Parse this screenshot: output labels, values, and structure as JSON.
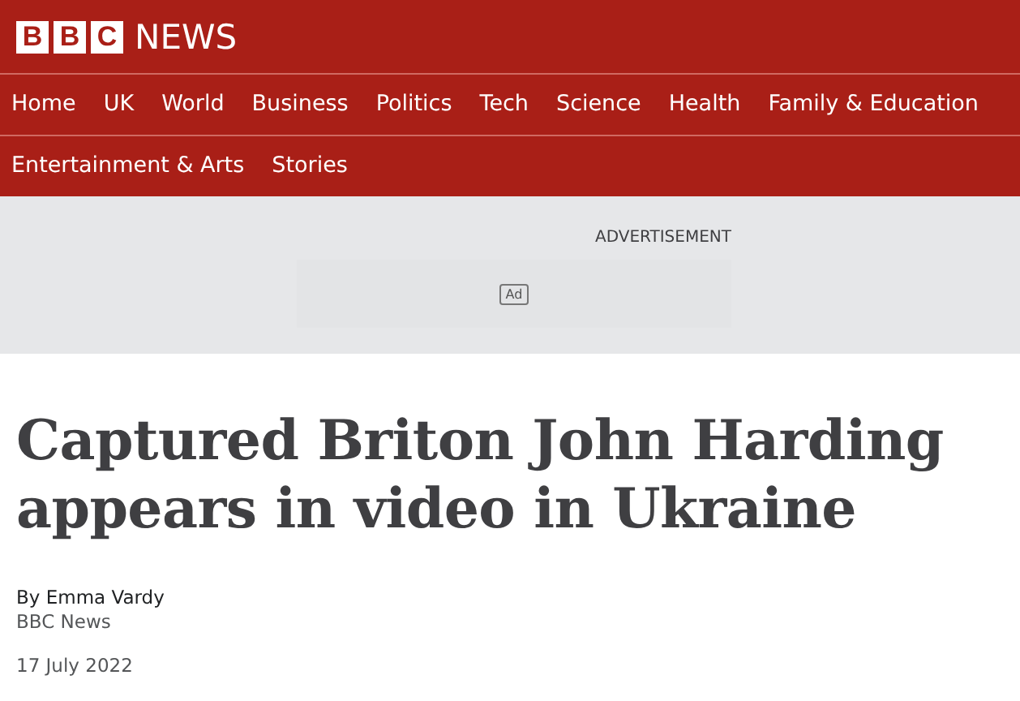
{
  "logo": {
    "letters": [
      "B",
      "B",
      "C"
    ],
    "word": "NEWS"
  },
  "nav": [
    {
      "label": "Home"
    },
    {
      "label": "UK"
    },
    {
      "label": "World"
    },
    {
      "label": "Business"
    },
    {
      "label": "Politics"
    },
    {
      "label": "Tech"
    },
    {
      "label": "Science"
    },
    {
      "label": "Health"
    },
    {
      "label": "Family & Education"
    },
    {
      "label": "Entertainment & Arts"
    },
    {
      "label": "Stories"
    }
  ],
  "advert": {
    "label": "ADVERTISEMENT",
    "badge": "Ad"
  },
  "article": {
    "headline": "Captured Briton John Harding appears in video in Ukraine",
    "byline": "By Emma Vardy",
    "source": "BBC News",
    "date": "17 July 2022"
  }
}
